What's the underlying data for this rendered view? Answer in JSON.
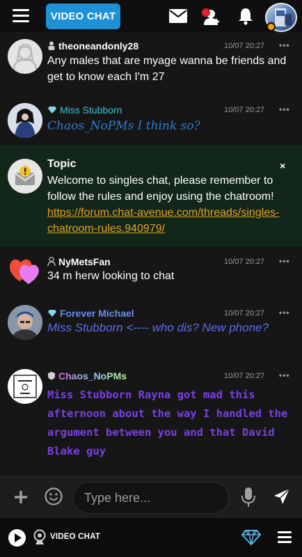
{
  "topbar": {
    "video_chat_label": "VIDEO CHAT",
    "icons": [
      "menu-icon",
      "mail-icon",
      "add-friend-icon",
      "bell-icon"
    ]
  },
  "messages": [
    {
      "username": "theoneandonly28",
      "time": "10/07 20:27",
      "text": "Any males that are myage wanna be friends and get to know each I'm 27",
      "name_color": "#ffffff",
      "text_color": "#ffffff"
    },
    {
      "username": "Miss Stubborn",
      "time": "10/07 20:27",
      "text": "Chaos_NoPMs I think so?",
      "name_color": "#3ec1d3",
      "text_color": "#2e7cd6"
    },
    {
      "username": "NyMetsFan",
      "time": "10/07 20:27",
      "text": "34 m herw looking to chat",
      "name_color": "#ffffff",
      "text_color": "#ffffff"
    },
    {
      "username": "Forever Michael",
      "time": "10/07 20:27",
      "text": "Miss Stubborn <---- who dis? New phone?",
      "name_color": "#6a8df0",
      "text_color": "#5a6cf0"
    },
    {
      "username": "Chaos_NoPMs",
      "time": "10/07 20:27",
      "text": "Miss Stubborn Rayna got mad this afternoon about the way I handled the argument between you and that David Blake guy",
      "text_color": "#7b3fe4"
    }
  ],
  "topic": {
    "title": "Topic",
    "text": "Welcome to singles chat, please remember to follow the rules and enjoy using the chatroom!",
    "link": "https://forum.chat-avenue.com/threads/singles-chatroom-rules.940979/",
    "close": "×"
  },
  "input": {
    "placeholder": "Type here..."
  },
  "bottombar": {
    "video_chat_label": "VIDEO CHAT"
  },
  "colors": {
    "accent": "#1e90d6",
    "topic_bg": "#13261a",
    "link": "#e5a021"
  }
}
